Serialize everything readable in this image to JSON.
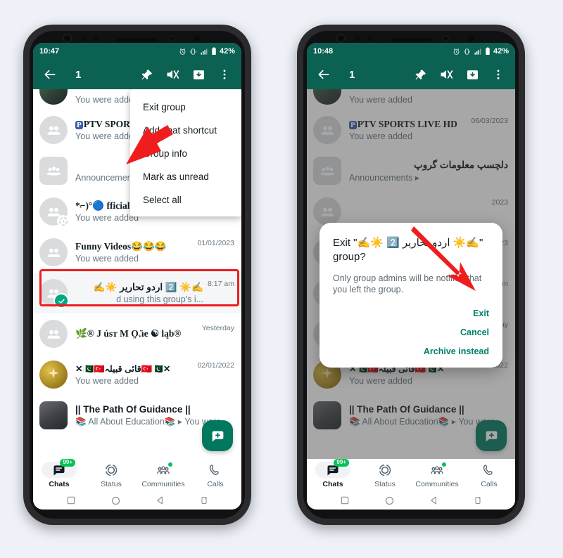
{
  "page": {
    "background": "#eef1f8",
    "accent_green": "#0b6152",
    "annotation_red": "#ef1d1d",
    "link_green": "#00806a"
  },
  "left_phone": {
    "status_bar": {
      "time": "10:47",
      "battery_percent": "42%",
      "icons": [
        "alarm-icon",
        "vibrate-icon",
        "signal-icon",
        "battery-icon"
      ]
    },
    "app_bar": {
      "back_icon": "back-arrow-icon",
      "selected_count": "1",
      "actions": [
        "pin-icon",
        "mute-icon",
        "archive-icon",
        "overflow-menu-icon"
      ]
    },
    "chats": [
      {
        "title": "",
        "subtitle": "You were added",
        "time": "",
        "avatar": "photo",
        "clipped": true
      },
      {
        "title": "PTV SPORTS LIVE HD",
        "subtitle": "You were added",
        "time": "",
        "avatar": "group",
        "badge_prefix": "P"
      },
      {
        "title": "دلچسپ معلومات گروپ",
        "subtitle": "Announcements ▸",
        "time": "",
        "avatar": "community",
        "rtl": true
      },
      {
        "title": "*⌐)°🔵 fficial ✘",
        "subtitle": "You were added",
        "time": "",
        "avatar": "group",
        "status_ring": true
      },
      {
        "title": "Funny Videos😂😂😂",
        "subtitle": "You were added",
        "time": "01/01/2023",
        "avatar": "group"
      },
      {
        "title": "✍️☀️ 2️⃣ اردو تحاریر ☀️✍️",
        "subtitle": "d using this group's i...",
        "time": "8:17 am",
        "avatar": "group",
        "selected": true,
        "highlighted": true
      },
      {
        "title": "🌿® J úsт M O̤ᵥ̈ıe ☯ ląb®",
        "subtitle": "",
        "time": "Yesterday",
        "avatar": "group"
      },
      {
        "title": "✕🇵🇰🇹🇷قائی قبیلہ🇹🇷🇵🇰✕",
        "subtitle": "You were added",
        "time": "02/01/2022",
        "avatar": "gold"
      },
      {
        "title": "|| The Path Of Guidance ||",
        "subtitle": "📚 All About Education📚 ▸ You were",
        "time": "",
        "avatar": "photo2",
        "square": true
      }
    ],
    "overflow_menu": {
      "items": [
        "Exit group",
        "Add chat shortcut",
        "Group info",
        "Mark as unread",
        "Select all"
      ]
    },
    "fab": {
      "icon": "new-chat-icon"
    },
    "bottom_nav": [
      {
        "label": "Chats",
        "icon": "chats-icon",
        "badge": "99+",
        "active": true
      },
      {
        "label": "Status",
        "icon": "status-icon",
        "active": false
      },
      {
        "label": "Communities",
        "icon": "communities-icon",
        "dot": true,
        "active": false
      },
      {
        "label": "Calls",
        "icon": "calls-icon",
        "active": false
      }
    ],
    "system_nav": [
      "recents-icon",
      "home-icon",
      "back-icon",
      "rotate-icon"
    ]
  },
  "right_phone": {
    "status_bar": {
      "time": "10:48",
      "battery_percent": "42%"
    },
    "app_bar": {
      "selected_count": "1"
    },
    "chats": [
      {
        "title": "",
        "subtitle": "You were added",
        "time": "",
        "avatar": "photo",
        "clipped": true
      },
      {
        "title": "PTV SPORTS LIVE HD",
        "subtitle": "You were added",
        "time": "06/03/2023",
        "avatar": "group",
        "badge_prefix": "P"
      },
      {
        "title": "دلچسپ معلومات گروپ",
        "subtitle": "Announcements ▸",
        "time": "",
        "avatar": "community",
        "rtl": true,
        "redacted": true
      },
      {
        "title": "",
        "subtitle": "",
        "time": "2023",
        "avatar": "group"
      },
      {
        "title": "",
        "subtitle": "",
        "time": "2023",
        "avatar": "group"
      },
      {
        "title": "",
        "subtitle": "",
        "time": "am",
        "avatar": "group"
      },
      {
        "title": "",
        "subtitle": "",
        "time": "...",
        "avatar": "group"
      },
      {
        "title": "",
        "subtitle": "",
        "time": "Yesterday",
        "avatar": "group"
      },
      {
        "title": "✕🇵🇰🇹🇷قائی قبیلہ🇹🇷🇵🇰✕",
        "subtitle": "You were added",
        "time": "02/01/2022",
        "avatar": "gold"
      },
      {
        "title": "|| The Path Of Guidance ||",
        "subtitle": "📚 All About Education📚 ▸ You were",
        "time": "",
        "avatar": "photo2",
        "square": true
      }
    ],
    "dialog": {
      "title": "Exit \"✍️☀️ 2️⃣ اردو تحاریر ☀️✍️\" group?",
      "body": "Only group admins will be notified that you left the group.",
      "buttons": [
        "Exit",
        "Cancel",
        "Archive instead"
      ]
    },
    "bottom_nav": [
      {
        "label": "Chats",
        "badge": "99+",
        "active": true
      },
      {
        "label": "Status",
        "active": false
      },
      {
        "label": "Communities",
        "dot": true,
        "active": false
      },
      {
        "label": "Calls",
        "active": false
      }
    ]
  },
  "annotations": [
    {
      "name": "arrow-to-exit-group",
      "color": "#ef1d1d"
    },
    {
      "name": "arrow-to-exit-button",
      "color": "#ef1d1d"
    },
    {
      "name": "highlight-selected-chat",
      "color": "#ef1d1d"
    }
  ]
}
